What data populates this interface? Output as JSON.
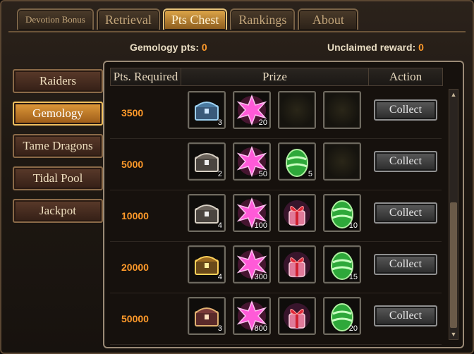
{
  "tabs": [
    {
      "label": "Devotion Bonus",
      "active": false
    },
    {
      "label": "Retrieval",
      "active": false
    },
    {
      "label": "Pts Chest",
      "active": true
    },
    {
      "label": "Rankings",
      "active": false
    },
    {
      "label": "About",
      "active": false
    }
  ],
  "info": {
    "gemology_label": "Gemology pts:",
    "gemology_value": "0",
    "unclaimed_label": "Unclaimed reward:",
    "unclaimed_value": "0"
  },
  "sidebar": [
    {
      "label": "Raiders",
      "active": false
    },
    {
      "label": "Gemology",
      "active": true
    },
    {
      "label": "Tame Dragons",
      "active": false
    },
    {
      "label": "Tidal Pool",
      "active": false
    },
    {
      "label": "Jackpot",
      "active": false
    }
  ],
  "table": {
    "headers": [
      "Pts. Required",
      "Prize",
      "Action"
    ],
    "rows": [
      {
        "pts": "3500",
        "action": "Collect",
        "prizes": [
          {
            "icon": "blue-chest-icon",
            "qty": "3"
          },
          {
            "icon": "pink-star-icon",
            "qty": "20"
          },
          {
            "icon": "empty-slot",
            "qty": ""
          },
          {
            "icon": "empty-slot",
            "qty": ""
          }
        ]
      },
      {
        "pts": "5000",
        "action": "Collect",
        "prizes": [
          {
            "icon": "silver-chest-icon",
            "qty": "2"
          },
          {
            "icon": "pink-star-icon",
            "qty": "50"
          },
          {
            "icon": "green-egg-icon",
            "qty": "5"
          },
          {
            "icon": "empty-slot",
            "qty": ""
          }
        ]
      },
      {
        "pts": "10000",
        "action": "Collect",
        "prizes": [
          {
            "icon": "silver-chest-icon",
            "qty": "4"
          },
          {
            "icon": "pink-star-icon",
            "qty": "100"
          },
          {
            "icon": "gift-box-icon",
            "qty": ""
          },
          {
            "icon": "green-egg-icon",
            "qty": "10"
          }
        ]
      },
      {
        "pts": "20000",
        "action": "Collect",
        "prizes": [
          {
            "icon": "gold-chest-icon",
            "qty": "4"
          },
          {
            "icon": "pink-star-icon",
            "qty": "300"
          },
          {
            "icon": "gift-box-icon",
            "qty": ""
          },
          {
            "icon": "green-egg-icon",
            "qty": "15"
          }
        ]
      },
      {
        "pts": "50000",
        "action": "Collect",
        "prizes": [
          {
            "icon": "red-chest-icon",
            "qty": "3"
          },
          {
            "icon": "pink-star-icon",
            "qty": "800"
          },
          {
            "icon": "gift-box-icon",
            "qty": ""
          },
          {
            "icon": "green-egg-icon",
            "qty": "20"
          }
        ]
      }
    ]
  },
  "colors": {
    "accent": "#ff9a2a",
    "active_tab": "#e0a84a"
  }
}
